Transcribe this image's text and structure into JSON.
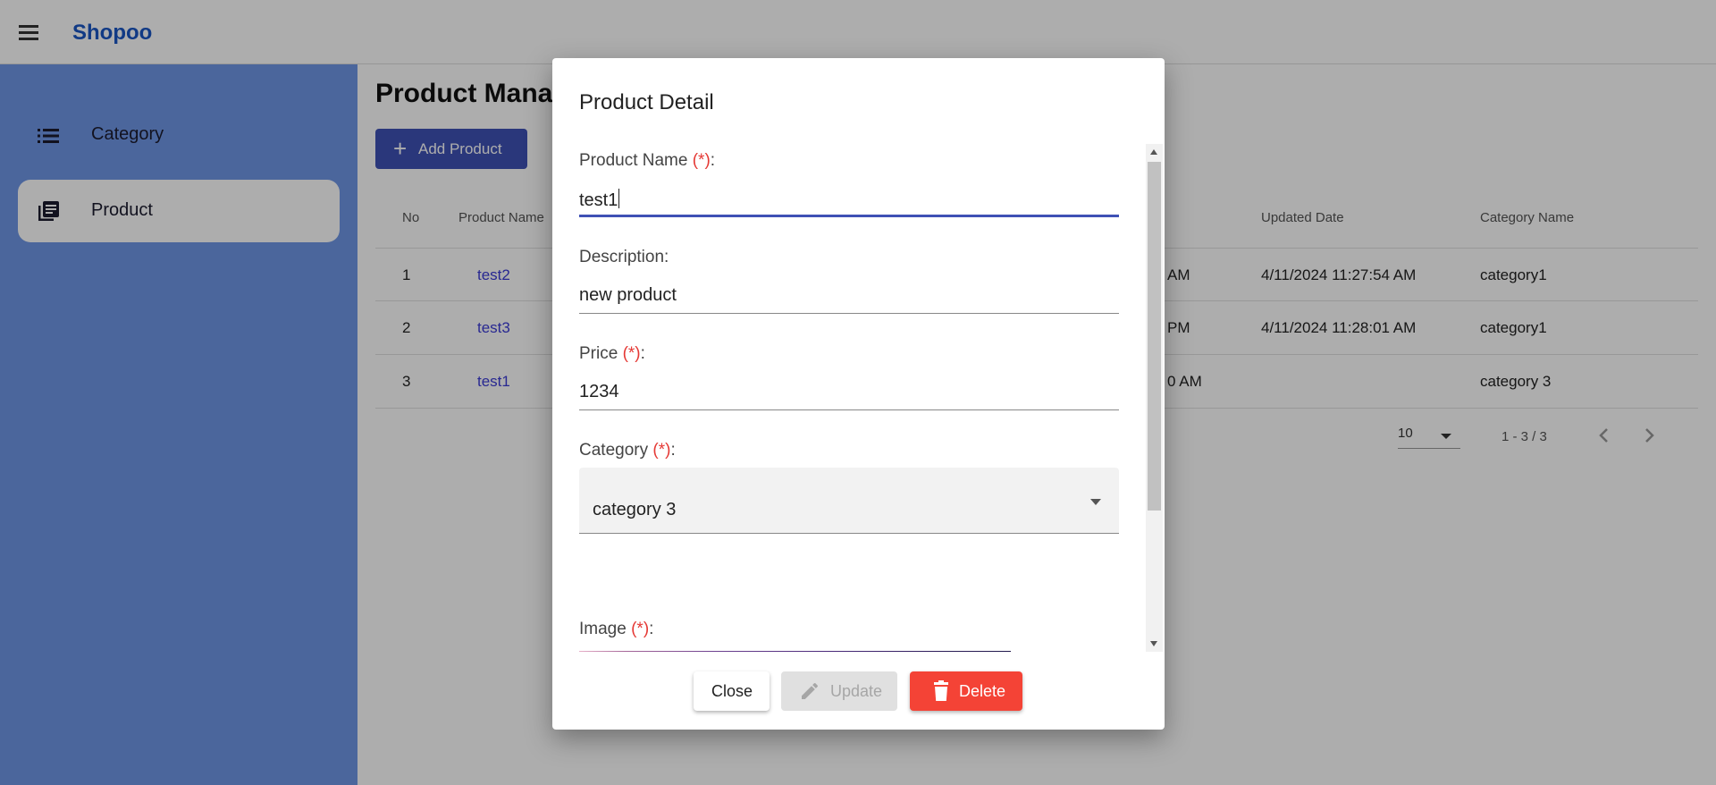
{
  "app": {
    "brand": "Shopoo"
  },
  "sidebar": {
    "items": [
      {
        "label": "Category",
        "icon": "list-icon"
      },
      {
        "label": "Product",
        "icon": "library-books-icon"
      }
    ]
  },
  "main": {
    "title": "Product Management",
    "add_button_label": "Add Product",
    "table": {
      "headers": {
        "no": "No",
        "product_name": "Product Name",
        "updated_date": "Updated Date",
        "category_name": "Category Name"
      },
      "rows": [
        {
          "no": "1",
          "name": "test2",
          "created_partial": "AM",
          "updated": "4/11/2024 11:27:54 AM",
          "category": "category1"
        },
        {
          "no": "2",
          "name": "test3",
          "created_partial": "PM",
          "updated": "4/11/2024 11:28:01 AM",
          "category": "category1"
        },
        {
          "no": "3",
          "name": "test1",
          "created_partial": "0 AM",
          "updated": "",
          "category": "category 3"
        }
      ]
    },
    "pagination": {
      "page_size": "10",
      "range": "1 - 3 / 3"
    }
  },
  "dialog": {
    "title": "Product Detail",
    "required_marker": "(*)",
    "fields": {
      "product_name": {
        "label": "Product Name",
        "value": "test1"
      },
      "description": {
        "label": "Description:",
        "value": "new product"
      },
      "price": {
        "label": "Price",
        "value": "1234"
      },
      "category": {
        "label": "Category",
        "value": "category 3"
      },
      "image": {
        "label": "Image"
      }
    },
    "buttons": {
      "close": "Close",
      "update": "Update",
      "delete": "Delete"
    }
  },
  "colors": {
    "brand": "#1a56c4",
    "sidebar": "#6f97e6",
    "primary": "#3f51b5",
    "danger": "#f44336",
    "required": "#e53935"
  }
}
